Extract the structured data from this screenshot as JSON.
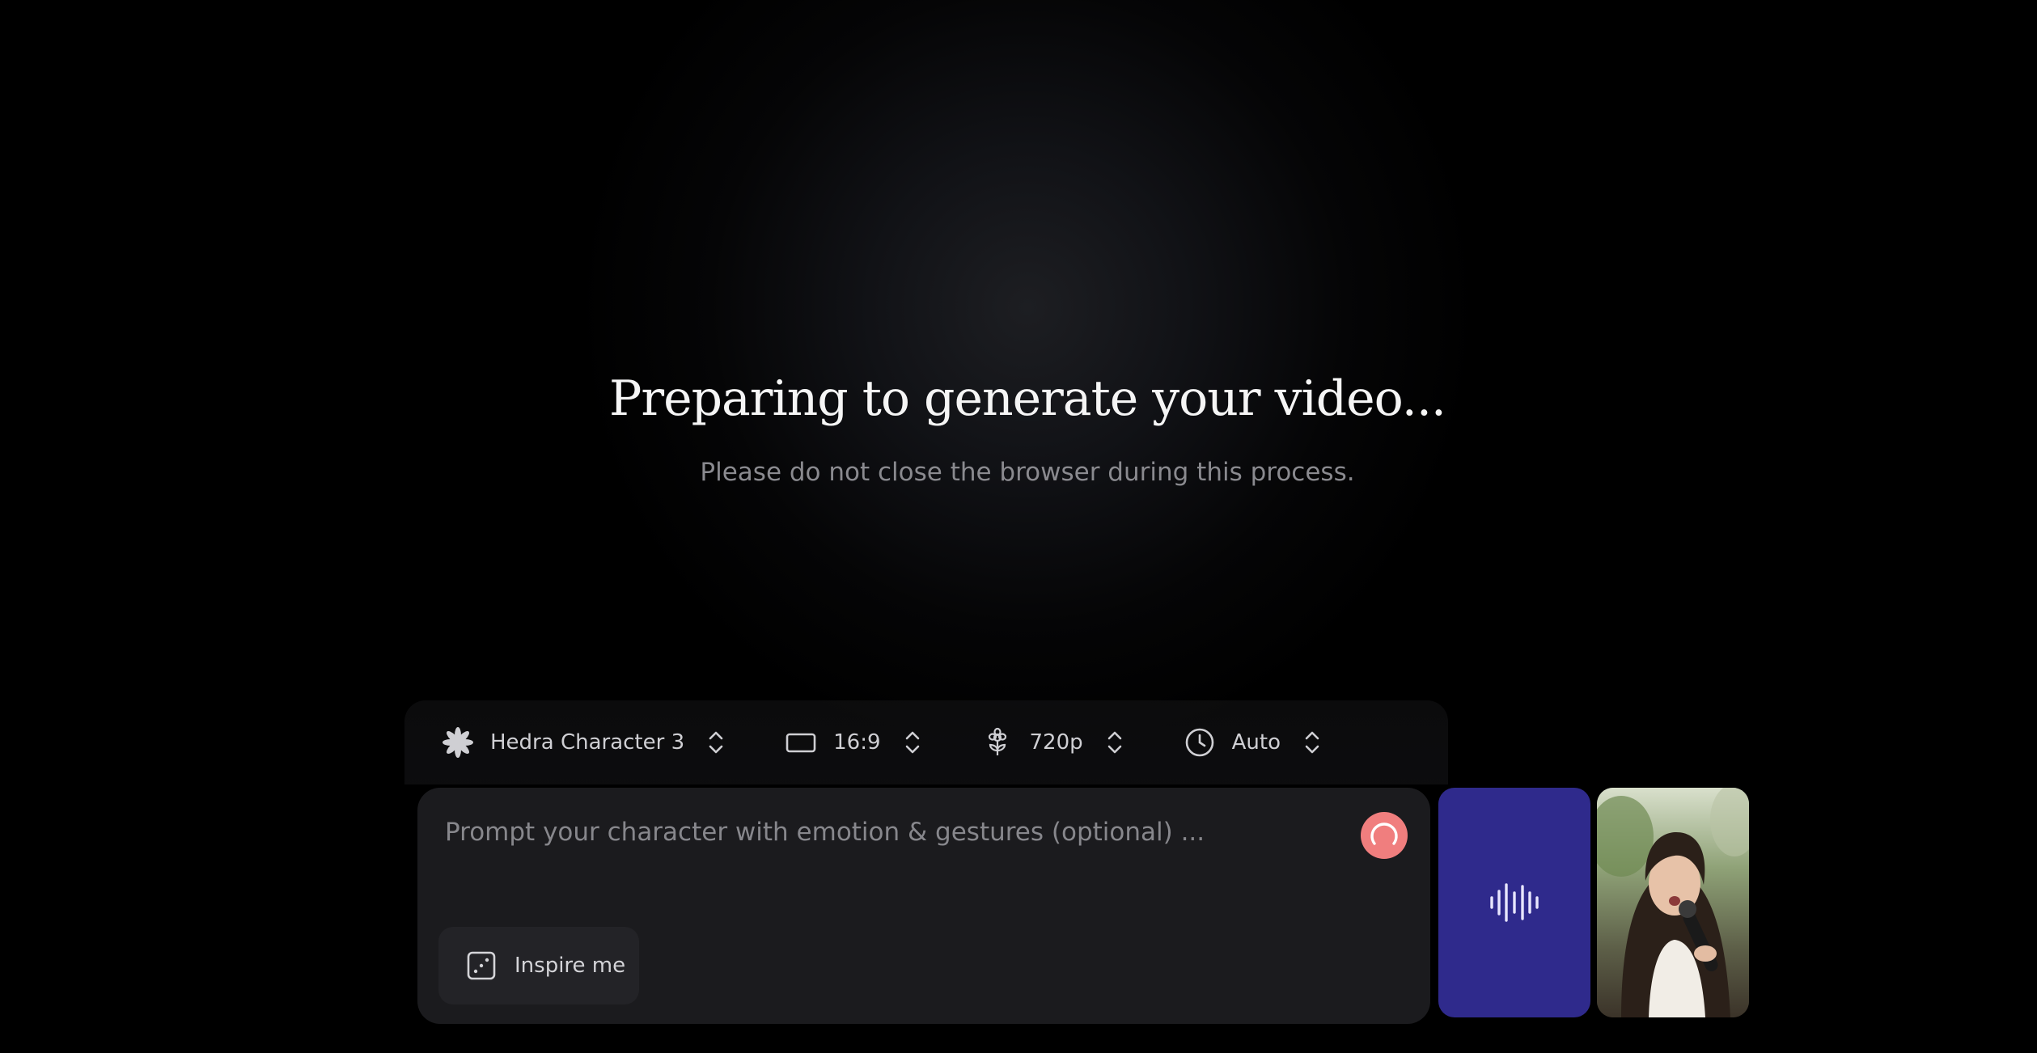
{
  "status": {
    "title": "Preparing to generate your video...",
    "subtitle": "Please do not close the browser during this process."
  },
  "settings": {
    "model": {
      "label": "Hedra Character 3",
      "icon": "model-flower-icon"
    },
    "aspect_ratio": {
      "label": "16:9",
      "icon": "aspect-ratio-icon"
    },
    "resolution": {
      "label": "720p",
      "icon": "resolution-flower-icon"
    },
    "duration": {
      "label": "Auto",
      "icon": "clock-icon"
    }
  },
  "prompt": {
    "placeholder": "Prompt your character with emotion & gestures (optional) ...",
    "value": ""
  },
  "inspire": {
    "label": "Inspire me",
    "icon": "dice-icon"
  },
  "media": {
    "audio": {
      "icon": "audio-waveform-icon",
      "color": "#2f2a8c"
    },
    "image": {
      "description_icon": "character-thumbnail"
    }
  },
  "colors": {
    "background": "#000000",
    "panel": "#1b1b1e",
    "accent_spinner": "#f07e7e",
    "audio_tile": "#2f2a8c"
  }
}
